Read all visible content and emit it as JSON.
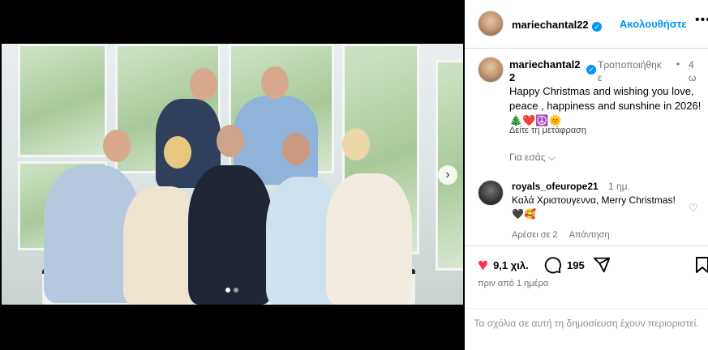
{
  "post": {
    "slide_count": 2,
    "active_slide": 1
  },
  "header": {
    "username": "mariechantal22",
    "follow_label": "Ακολουθήστε",
    "more_icon": "more-horizontal-icon"
  },
  "caption": {
    "username_line1": "mariechantal2",
    "username_line2": "2",
    "edited_line1": "Τροποποιήθηκ",
    "edited_line2": "ε",
    "time_line1": "4",
    "time_line2": "ω",
    "text": "Happy Christmas and wishing you love, peace , happiness and sunshine in 2026!",
    "emojis": "🎄❤️☮️🌞",
    "translate_label": "Δείτε τη μετάφραση",
    "for_you_label": "Για εσάς"
  },
  "comment": {
    "username": "royals_ofeurope21",
    "time": "1 ημ.",
    "text": "Καλά Χριστουγεννα, Merry Christmas! 🖤🥰",
    "likes_label": "Αρέσει σε 2",
    "reply_label": "Απάντηση"
  },
  "actions": {
    "likes": "9,1 χιλ.",
    "comments": "195",
    "like_color": "#ff3040"
  },
  "date_label": "πριν από 1 ημέρα",
  "comments_restricted": "Τα σχόλια σε αυτή τη δημοσίευση έχουν περιοριστεί."
}
